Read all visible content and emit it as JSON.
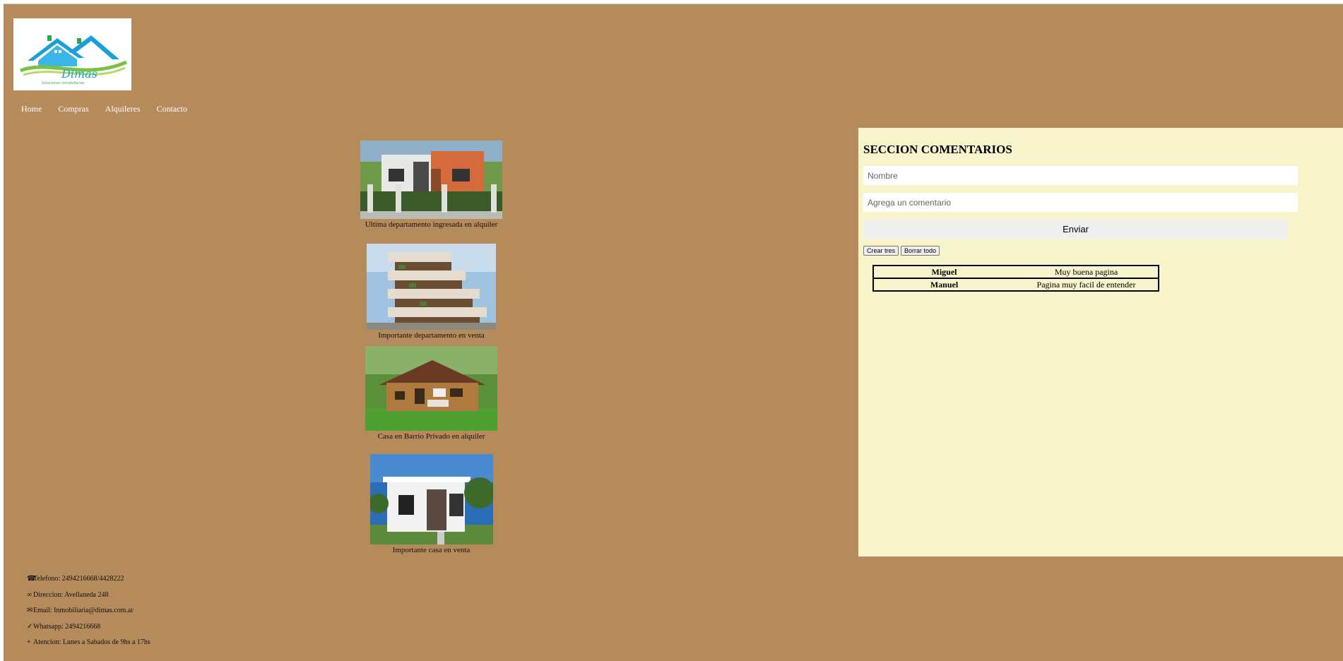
{
  "logo": {
    "text": "Dimas",
    "subtitle": "Soluciones inmobiliarias"
  },
  "nav": [
    "Home",
    "Compras",
    "Alquileres",
    "Contacto"
  ],
  "gallery": [
    {
      "caption": "Ultima departamento ingresada en alquiler"
    },
    {
      "caption": "Importante departamento en venta"
    },
    {
      "caption": "Casa en Barrio Privado en alquiler"
    },
    {
      "caption": "Importante casa en venta"
    }
  ],
  "comments": {
    "title": "SECCION COMENTARIOS",
    "name_placeholder": "Nombre",
    "comment_placeholder": "Agrega un comentario",
    "send_label": "Enviar",
    "create_label": "Crear tres",
    "clear_label": "Borrar todo",
    "rows": [
      {
        "name": "Miguel",
        "text": "Muy buena pagina"
      },
      {
        "name": "Manuel",
        "text": "Pagina muy facil de entender"
      }
    ]
  },
  "footer": {
    "phone_icon": "☎",
    "phone": "Telefono: 2494216668/4428222",
    "address_icon": "∞",
    "address": "Direccion: Avellaneda 248",
    "email_icon": "✉",
    "email": "Email: Inmobiliaria@dimas.com.ar",
    "whatsapp_icon": "✓",
    "whatsapp": "Whatsapp: 2494216668",
    "hours_icon": "+",
    "hours": "Atencion: Lunes a Sabados de 9hs a 17hs"
  }
}
